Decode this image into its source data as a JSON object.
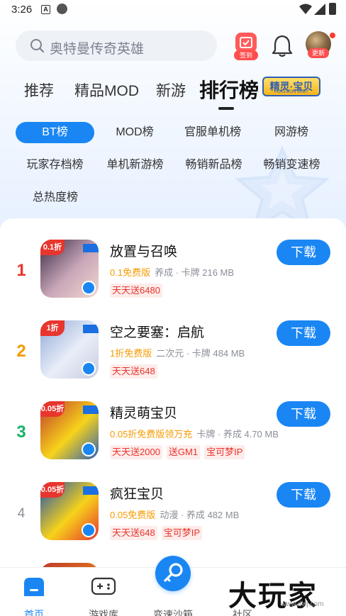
{
  "status_bar": {
    "time": "3:26",
    "a_icon": "A"
  },
  "search": {
    "placeholder": "奥特曼传奇英雄"
  },
  "checkin": {
    "label": "签到"
  },
  "avatar": {
    "badge": "更新"
  },
  "tabs": [
    {
      "label": "推荐"
    },
    {
      "label": "精品MOD"
    },
    {
      "label": "新游"
    },
    {
      "label": "排行榜",
      "active": true
    }
  ],
  "tab_logo": {
    "text": "精灵·宝贝",
    "sub": "POKEMON BABY"
  },
  "rank_tabs": [
    {
      "label": "BT榜",
      "active": true
    },
    {
      "label": "MOD榜"
    },
    {
      "label": "官服单机榜"
    },
    {
      "label": "网游榜"
    },
    {
      "label": "玩家存档榜"
    },
    {
      "label": "单机新游榜"
    },
    {
      "label": "畅销新品榜"
    },
    {
      "label": "畅销变速榜"
    },
    {
      "label": "总热度榜"
    }
  ],
  "games": [
    {
      "rank": "1",
      "rank_color": "#e8352d",
      "name": "放置与召唤",
      "discount": "0.1免费版",
      "info": "养成 · 卡牌  216 MB",
      "tags": [
        "天天送6480"
      ],
      "download": "下载",
      "corner": "0.1折",
      "icon_colors": [
        "#3a2a45",
        "#c9a7b8",
        "#f1d8d0"
      ]
    },
    {
      "rank": "2",
      "rank_color": "#f59a00",
      "name": "空之要塞：启航",
      "discount": "1折免费版",
      "info": "二次元 · 卡牌  484 MB",
      "tags": [
        "天天送648"
      ],
      "download": "下载",
      "corner": "1折",
      "icon_colors": [
        "#8fa8d8",
        "#e9eef8",
        "#c7cce0"
      ]
    },
    {
      "rank": "3",
      "rank_color": "#17b26a",
      "name": "精灵萌宝贝",
      "discount": "0.05折免费版领万充",
      "info": "卡牌 · 养成  4.70 MB",
      "tags": [
        "天天送2000",
        "送GM1",
        "宝可梦IP"
      ],
      "download": "下载",
      "corner": "0.05折",
      "icon_colors": [
        "#c0392b",
        "#f7d31b",
        "#2f5fb5"
      ]
    },
    {
      "rank": "4",
      "rank_color": "#8a8f98",
      "name": "疯狂宝贝",
      "discount": "0.05免费版",
      "info": "动漫 · 养成  482 MB",
      "tags": [
        "天天送648",
        "宝可梦IP"
      ],
      "download": "下载",
      "corner": "0.05折",
      "icon_colors": [
        "#1a4fb0",
        "#f7d31b",
        "#e8352d"
      ]
    }
  ],
  "bottom_nav": [
    {
      "label": "首页",
      "active": true,
      "icon": "home-icon"
    },
    {
      "label": "游戏库",
      "icon": "gamepad-icon"
    },
    {
      "label": "变速沙箱",
      "icon": "speed-sandbox-icon"
    },
    {
      "label": "社区",
      "icon": "community-icon"
    }
  ],
  "watermark": {
    "main": "大玩家",
    "sub": "www.dwj.com"
  }
}
